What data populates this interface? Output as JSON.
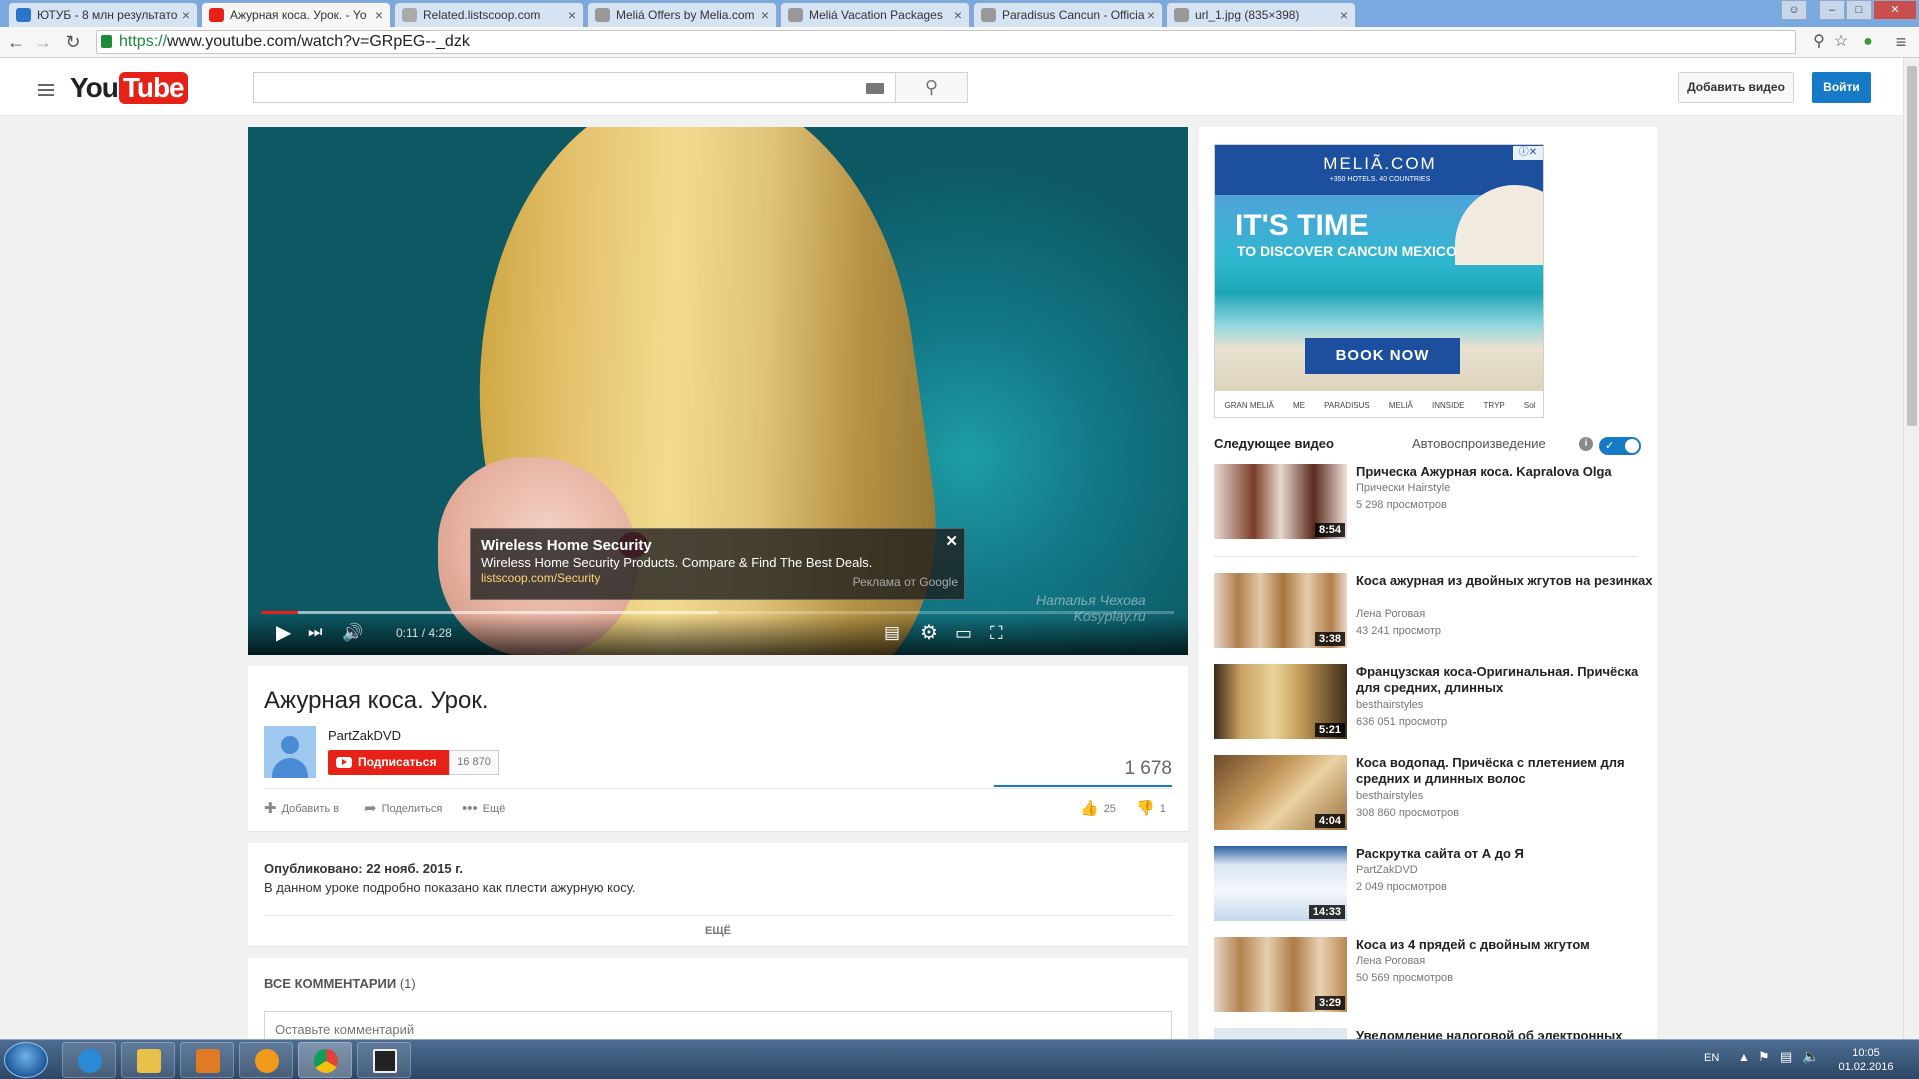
{
  "browser": {
    "tabs": [
      {
        "label": "ЮТУБ - 8 млн результато",
        "active": false
      },
      {
        "label": "Ажурная коса. Урок. - Yo",
        "active": true
      },
      {
        "label": "Related.listscoop.com",
        "active": false
      },
      {
        "label": "Meliá Offers by Melia.com",
        "active": false
      },
      {
        "label": "Meliá Vacation Packages",
        "active": false
      },
      {
        "label": "Paradisus Cancun - Officia",
        "active": false
      },
      {
        "label": "url_1.jpg (835×398)",
        "active": false
      }
    ],
    "url_scheme": "https://",
    "url_domain": "www.youtube.com",
    "url_path": "/watch?v=GRpEG--_dzk"
  },
  "header": {
    "logo_you": "You",
    "logo_tube": "Tube",
    "search_placeholder": "",
    "add_video": "Добавить видео",
    "login": "Войти"
  },
  "player": {
    "watermark_line1": "Наталья Чехова",
    "watermark_line2": "Kosyplay.ru",
    "ad": {
      "title": "Wireless Home Security",
      "description": "Wireless Home Security Products. Compare & Find The Best Deals.",
      "url": "listscoop.com/Security",
      "by": "Реклама от Google"
    },
    "current_time": "0:11",
    "duration": "4:28",
    "time_display": "0:11 / 4:28",
    "progress_fraction": 0.041,
    "buffered_fraction": 0.5
  },
  "video": {
    "title": "Ажурная коса. Урок.",
    "channel": "PartZakDVD",
    "subscribe": "Подписаться",
    "subscribers": "16 870",
    "views": "1 678",
    "actions": {
      "add": "Добавить в",
      "share": "Поделиться",
      "more": "Ещё"
    },
    "likes": "25",
    "dislikes": "1",
    "published": "Опубликовано: 22 нояб. 2015 г.",
    "description": "В данном уроке подробно показано как плести ажурную косу.",
    "show_more": "ЕЩЁ",
    "comments_header": "ВСЕ КОММЕНТАРИИ",
    "comments_count": "(1)",
    "comment_placeholder": "Оставьте комментарий"
  },
  "sidebar_ad": {
    "brand": "MELIÃ.COM",
    "brand_sub": "+350 HOTELS. 40 COUNTRIES",
    "headline1": "IT'S TIME",
    "headline2": "TO DISCOVER CANCUN MEXICO",
    "button": "BOOK NOW",
    "brands": [
      "GRAN MELIÃ",
      "ME",
      "PARADISUS",
      "MELIÃ",
      "INNSIDE",
      "TRYP",
      "Sol"
    ]
  },
  "sidebar": {
    "next_label": "Следующее видео",
    "autoplay_label": "Автовоспроизведение",
    "autoplay_on": true,
    "items": [
      {
        "title": "Прическа Ажурная коса. Kapralova Olga",
        "channel": "Прически Hairstyle",
        "views": "5 298 просмотров",
        "duration": "8:54"
      },
      {
        "title": "Коса ажурная из двойных жгутов на резинках",
        "channel": "Лена Роговая",
        "views": "43 241 просмотр",
        "duration": "3:38"
      },
      {
        "title": "Французская коса-Оригинальная. Причёска для средних, длинных",
        "channel": "besthairstyles",
        "views": "636 051 просмотр",
        "duration": "5:21"
      },
      {
        "title": "Коса водопад. Причёска с плетением для средних и длинных волос",
        "channel": "besthairstyles",
        "views": "308 860 просмотров",
        "duration": "4:04"
      },
      {
        "title": "Раскрутка сайта от А до Я",
        "channel": "PartZakDVD",
        "views": "2 049 просмотров",
        "duration": "14:33"
      },
      {
        "title": "Коса из 4 прядей с двойным жгутом",
        "channel": "Лена Роговая",
        "views": "50 569 просмотров",
        "duration": "3:29"
      },
      {
        "title": "Уведомление налоговой об электронных",
        "channel": "",
        "views": "",
        "duration": ""
      }
    ]
  },
  "taskbar": {
    "lang": "EN",
    "time": "10:05",
    "date": "01.02.2016"
  }
}
